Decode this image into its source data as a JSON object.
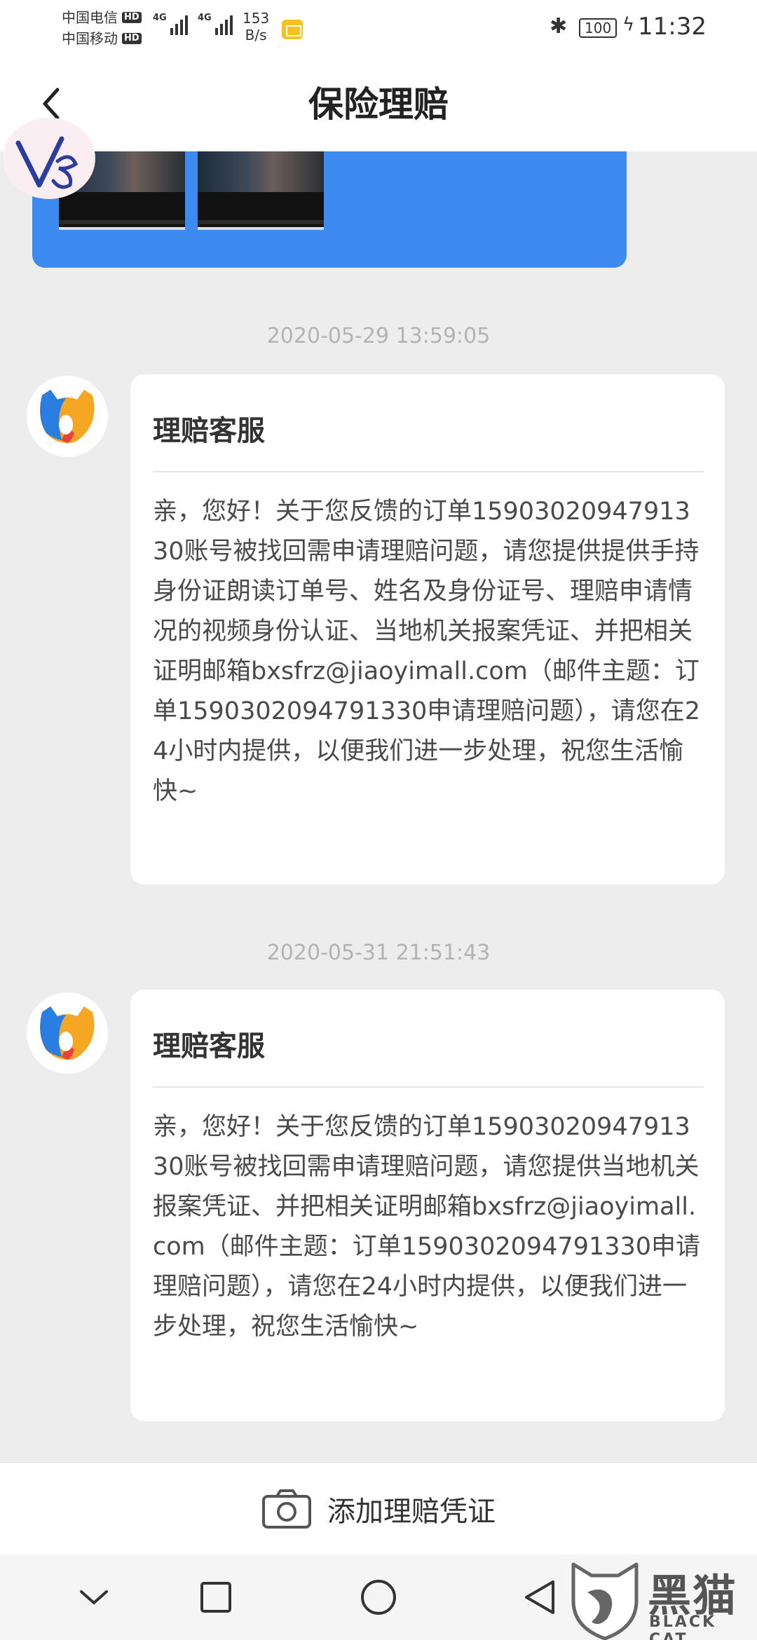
{
  "status_bar": {
    "carrier1": "中国电信",
    "carrier2": "中国移动",
    "hd_label": "HD",
    "network1": "4G",
    "network2": "4G",
    "speed_value": "153",
    "speed_unit": "B/s",
    "battery": "100",
    "time": "11:32",
    "icons": [
      "signal-icon",
      "mail-notification-icon",
      "bluetooth-icon",
      "battery-icon",
      "charging-icon"
    ]
  },
  "header": {
    "title": "保险理赔",
    "back_icon": "back-arrow-icon"
  },
  "messages": [
    {
      "timestamp": "2020-05-29 13:59:05",
      "sender": "理赔客服",
      "text": "亲，您好！关于您反馈的订单1590302094791330账号被找回需申请理赔问题，请您提供提供手持身份证朗读订单号、姓名及身份证号、理赔申请情况的视频身份认证、当地机关报案凭证、并把相关证明邮箱bxsfrz@jiaoyimall.com（邮件主题：订单1590302094791330申请理赔问题），请您在24小时内提供，以便我们进一步处理，祝您生活愉快~"
    },
    {
      "timestamp": "2020-05-31 21:51:43",
      "sender": "理赔客服",
      "text": "亲，您好！关于您反馈的订单1590302094791330账号被找回需申请理赔问题，请您提供当地机关报案凭证、并把相关证明邮箱bxsfrz@jiaoyimall.com（邮件主题：订单1590302094791330申请理赔问题），请您在24小时内提供，以便我们进一步处理，祝您生活愉快~"
    }
  ],
  "action_bar": {
    "add_proof_label": "添加理赔凭证",
    "icon": "camera-icon"
  },
  "nav_bar": {
    "icons": [
      "chevron-down-icon",
      "recent-apps-icon",
      "home-icon",
      "back-icon"
    ]
  },
  "watermark": {
    "cn": "黑猫",
    "en": "BLACK CAT"
  },
  "colors": {
    "accent_blue": "#3d8af0",
    "background": "#ededed",
    "card": "#ffffff",
    "timestamp": "#b3b3b3"
  }
}
